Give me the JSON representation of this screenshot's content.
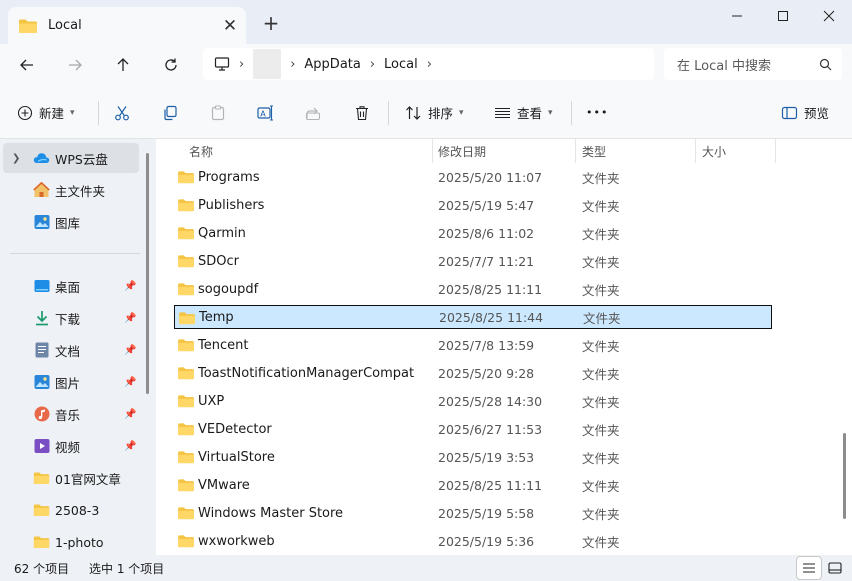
{
  "tab": {
    "title": "Local",
    "icon": "folder-icon"
  },
  "address": {
    "breadcrumbs": [
      "AppData",
      "Local"
    ],
    "search_placeholder": "在 Local 中搜索"
  },
  "toolbar": {
    "new_label": "新建",
    "sort_label": "排序",
    "view_label": "查看",
    "more_label": "•••",
    "preview_label": "预览"
  },
  "columns": {
    "name": "名称",
    "date": "修改日期",
    "type": "类型",
    "size": "大小"
  },
  "sidebar": {
    "items": [
      {
        "label": "WPS云盘",
        "icon": "cloud-icon",
        "chevron": true,
        "selected": true
      },
      {
        "label": "主文件夹",
        "icon": "home-icon"
      },
      {
        "label": "图库",
        "icon": "gallery-icon"
      },
      {
        "label": "桌面",
        "icon": "desktop-icon",
        "pinned": true
      },
      {
        "label": "下载",
        "icon": "download-icon",
        "pinned": true
      },
      {
        "label": "文档",
        "icon": "document-icon",
        "pinned": true
      },
      {
        "label": "图片",
        "icon": "pictures-icon",
        "pinned": true
      },
      {
        "label": "音乐",
        "icon": "music-icon",
        "pinned": true
      },
      {
        "label": "视频",
        "icon": "video-icon",
        "pinned": true
      },
      {
        "label": "01官网文章",
        "icon": "folder-icon"
      },
      {
        "label": "2508-3",
        "icon": "folder-icon"
      },
      {
        "label": "1-photo",
        "icon": "folder-icon"
      }
    ]
  },
  "files": [
    {
      "name": "Programs",
      "date": "2025/5/20 11:07",
      "type": "文件夹"
    },
    {
      "name": "Publishers",
      "date": "2025/5/19 5:47",
      "type": "文件夹"
    },
    {
      "name": "Qarmin",
      "date": "2025/8/6 11:02",
      "type": "文件夹"
    },
    {
      "name": "SDOcr",
      "date": "2025/7/7 11:21",
      "type": "文件夹"
    },
    {
      "name": "sogoupdf",
      "date": "2025/8/25 11:11",
      "type": "文件夹"
    },
    {
      "name": "Temp",
      "date": "2025/8/25 11:44",
      "type": "文件夹",
      "selected": true
    },
    {
      "name": "Tencent",
      "date": "2025/7/8 13:59",
      "type": "文件夹"
    },
    {
      "name": "ToastNotificationManagerCompat",
      "date": "2025/5/20 9:28",
      "type": "文件夹"
    },
    {
      "name": "UXP",
      "date": "2025/5/28 14:30",
      "type": "文件夹"
    },
    {
      "name": "VEDetector",
      "date": "2025/6/27 11:53",
      "type": "文件夹"
    },
    {
      "name": "VirtualStore",
      "date": "2025/5/19 3:53",
      "type": "文件夹"
    },
    {
      "name": "VMware",
      "date": "2025/8/25 11:11",
      "type": "文件夹"
    },
    {
      "name": "Windows Master Store",
      "date": "2025/5/19 5:58",
      "type": "文件夹"
    },
    {
      "name": "wxworkweb",
      "date": "2025/5/19 5:36",
      "type": "文件夹"
    }
  ],
  "status": {
    "count": "62 个项目",
    "selected": "选中 1 个项目"
  },
  "colors": {
    "folder": "#f4c542",
    "selection": "#cce8ff",
    "accent": "#0067c0"
  }
}
